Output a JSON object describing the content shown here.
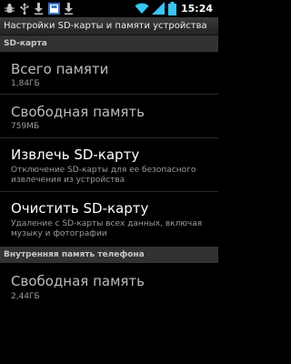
{
  "status_bar": {
    "time": "15:24",
    "icons": [
      "usb-debug-icon",
      "usb-icon",
      "download-icon",
      "sd-card-icon",
      "download-icon",
      "wifi-icon",
      "signal-icon",
      "battery-icon"
    ],
    "accent_color": "#39c6f3"
  },
  "title_bar": {
    "title": "Настройки SD-карты и памяти устройства"
  },
  "sections": {
    "sd_card": {
      "header": "SD-карта",
      "total": {
        "label": "Всего памяти",
        "value": "1,84ГБ"
      },
      "free": {
        "label": "Свободная память",
        "value": "759МБ"
      },
      "unmount": {
        "label": "Извлечь SD-карту",
        "summary": "Отключение SD-карты для ее безопасного извлечения из устройства"
      },
      "erase": {
        "label": "Очистить SD-карту",
        "summary": "Удаление с SD-карты всех данных, включая музыку и фотографии"
      }
    },
    "internal": {
      "header": "Внутренняя память телефона",
      "free": {
        "label": "Свободная память",
        "value": "2,44ГБ"
      }
    }
  }
}
